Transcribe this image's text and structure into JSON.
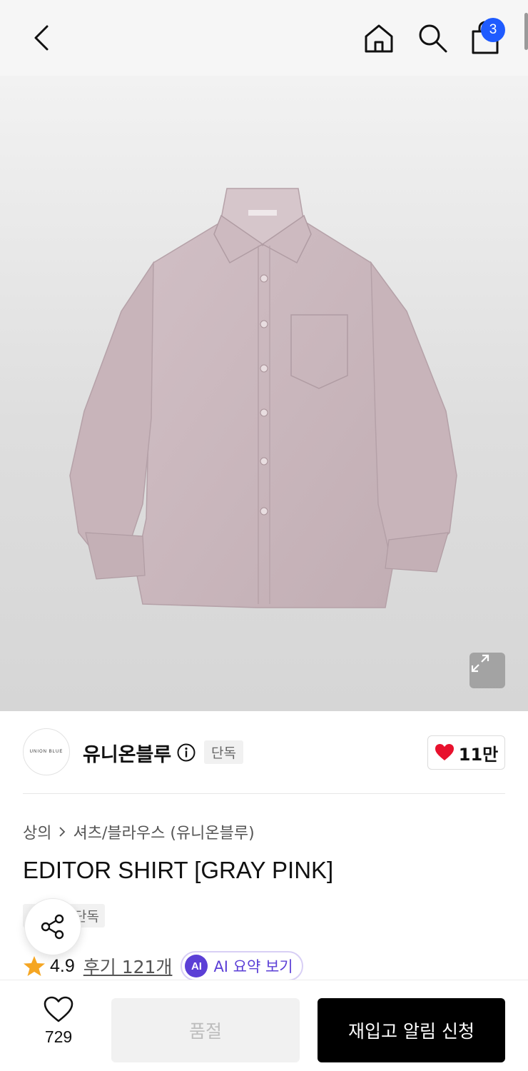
{
  "header": {
    "back_icon": "chevron-left-icon",
    "home_icon": "home-icon",
    "search_icon": "search-icon",
    "cart_icon": "shopping-bag-icon",
    "cart_count": "3",
    "badge_color": "#1f5bff"
  },
  "hero": {
    "expand_icon": "expand-icon",
    "shirt_label": "UNION BLUE",
    "shirt_color": "#c9b6bc"
  },
  "brand": {
    "logo_text": "UNION BLUE",
    "name": "유니온블루",
    "info_icon": "info-icon",
    "exclusive_badge": "단독",
    "like_icon": "heart-icon",
    "like_count": "11만"
  },
  "product": {
    "breadcrumb": [
      "상의",
      "셔츠/블라우스 (유니온블루)"
    ],
    "title": "EDITOR SHIRT [GRAY PINK]",
    "tag": "단독",
    "share_icon": "share-icon",
    "rating": "4.9",
    "star_icon": "star-icon",
    "reviews": "후기 121개",
    "ai_badge": "AI",
    "ai_summary": "AI 요약 보기"
  },
  "bottom": {
    "wish_icon": "heart-outline-icon",
    "wish_count": "729",
    "soldout_label": "품절",
    "restock_label": "재입고 알림 신청"
  },
  "colors": {
    "accent": "#5b3fd6",
    "heart": "#e8112d",
    "star": "#f5a623"
  }
}
